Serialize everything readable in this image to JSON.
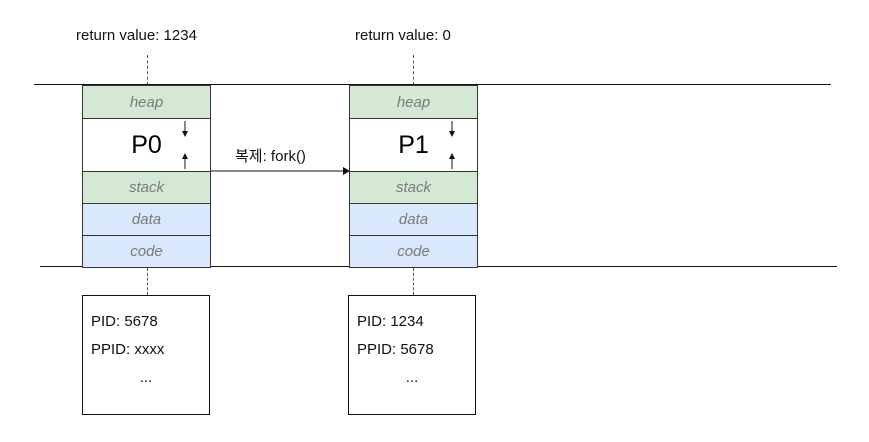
{
  "parent": {
    "return_label": "return value: 1234",
    "name": "P0",
    "segments": {
      "heap": "heap",
      "stack": "stack",
      "data": "data",
      "code": "code"
    },
    "info": {
      "pid": "PID: 5678",
      "ppid": "PPID: xxxx",
      "more": "..."
    }
  },
  "child": {
    "return_label": "return value: 0",
    "name": "P1",
    "segments": {
      "heap": "heap",
      "stack": "stack",
      "data": "data",
      "code": "code"
    },
    "info": {
      "pid": "PID: 1234",
      "ppid": "PPID: 5678",
      "more": "..."
    }
  },
  "fork_label": "복제: fork()",
  "colors": {
    "green": "#d5e8d4",
    "blue": "#dae8fc",
    "line": "#111111",
    "text_muted": "#7a7a7a"
  }
}
